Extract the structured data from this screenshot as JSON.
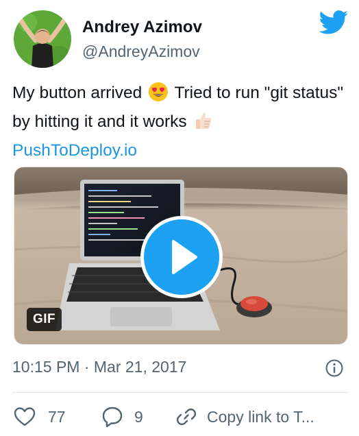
{
  "tweet": {
    "author_name": "Andrey Azimov",
    "author_handle": "@AndreyAzimov",
    "text_part1": "My button arrived",
    "text_part2": "Tried to run \"git status\" by hitting it and it works",
    "link": "PushToDeploy.io",
    "timestamp": "10:15 PM · Mar 21, 2017"
  },
  "media": {
    "badge": "GIF",
    "kind": "animated-gif-video"
  },
  "actions": {
    "like_count": "77",
    "reply_count": "9",
    "copy_label": "Copy link to T..."
  },
  "icons": {
    "brand": "twitter-bird-icon",
    "emoji_1": "heart-eyes-emoji",
    "emoji_2": "thumbs-up-emoji",
    "info": "info-icon",
    "like": "heart-icon",
    "reply": "reply-bubble-icon",
    "copy": "link-icon",
    "play": "play-icon"
  },
  "colors": {
    "brand_blue": "#1da1f2",
    "link_blue": "#1b95e0",
    "secondary_text": "#536471",
    "primary_text": "#0f1419"
  }
}
